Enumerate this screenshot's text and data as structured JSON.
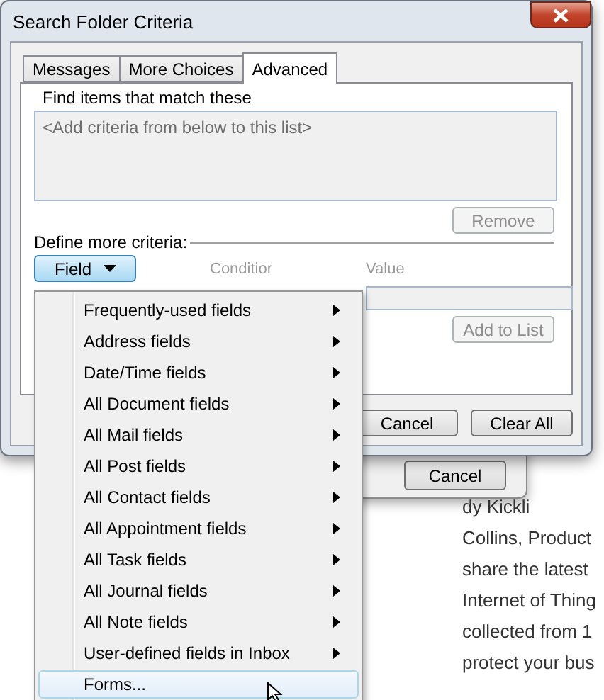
{
  "background": {
    "button": "Cancel",
    "article_lines": [
      "dy Kickli",
      "Collins, Product",
      "share the latest",
      "Internet of Thing",
      "collected from 1",
      "protect your bus"
    ]
  },
  "dialog": {
    "title": "Search Folder Criteria",
    "tabs": [
      {
        "label": "Messages",
        "selected": false
      },
      {
        "label": "More Choices",
        "selected": false
      },
      {
        "label": "Advanced",
        "selected": true
      }
    ],
    "criteria_label": "Find items that match these",
    "criteria_list_text": "<Add criteria from below to this list>",
    "remove_button": {
      "label": "Remove",
      "disabled": true
    },
    "define_label": "Define more criteria:",
    "field_button": "Field",
    "condition_label": "Conditior",
    "value_label": "Value",
    "add_button": {
      "label": "Add to List",
      "disabled": true
    },
    "buttons": [
      "Cancel",
      "Clear All"
    ]
  },
  "menu": {
    "items": [
      {
        "label": "Frequently-used fields",
        "submenu": true,
        "selected": false
      },
      {
        "label": "Address fields",
        "submenu": true,
        "selected": false
      },
      {
        "label": "Date/Time fields",
        "submenu": true,
        "selected": false
      },
      {
        "label": "All Document fields",
        "submenu": true,
        "selected": false
      },
      {
        "label": "All Mail fields",
        "submenu": true,
        "selected": false
      },
      {
        "label": "All Post fields",
        "submenu": true,
        "selected": false
      },
      {
        "label": "All Contact fields",
        "submenu": true,
        "selected": false
      },
      {
        "label": "All Appointment fields",
        "submenu": true,
        "selected": false
      },
      {
        "label": "All Task fields",
        "submenu": true,
        "selected": false
      },
      {
        "label": "All Journal fields",
        "submenu": true,
        "selected": false
      },
      {
        "label": "All Note fields",
        "submenu": true,
        "selected": false
      },
      {
        "label": "User-defined fields in Inbox",
        "submenu": true,
        "selected": false
      },
      {
        "label": "Forms...",
        "submenu": false,
        "selected": true
      }
    ]
  }
}
